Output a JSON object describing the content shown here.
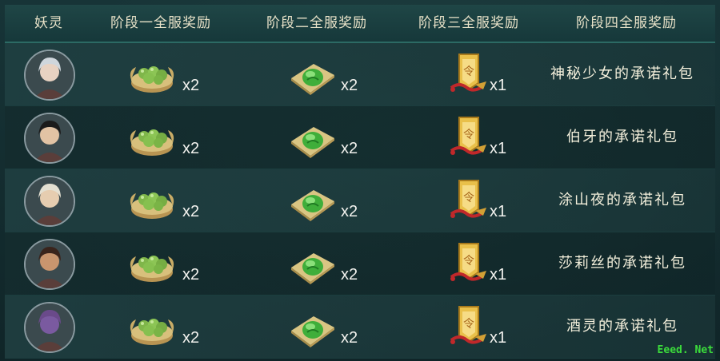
{
  "header": {
    "col_spirit": "妖灵",
    "col_stage1": "阶段一全服奖励",
    "col_stage2": "阶段二全服奖励",
    "col_stage3": "阶段三全服奖励",
    "col_stage4": "阶段四全服奖励"
  },
  "rows": [
    {
      "stage1_qty": "x2",
      "stage2_qty": "x2",
      "stage3_qty": "x1",
      "gift": "神秘少女的承诺礼包",
      "avatar_icon": "silver-hair-girl-avatar"
    },
    {
      "stage1_qty": "x2",
      "stage2_qty": "x2",
      "stage3_qty": "x1",
      "gift": "伯牙的承诺礼包",
      "avatar_icon": "black-hair-man-avatar"
    },
    {
      "stage1_qty": "x2",
      "stage2_qty": "x2",
      "stage3_qty": "x1",
      "gift": "涂山夜的承诺礼包",
      "avatar_icon": "white-hair-man-avatar"
    },
    {
      "stage1_qty": "x2",
      "stage2_qty": "x2",
      "stage3_qty": "x1",
      "gift": "莎莉丝的承诺礼包",
      "avatar_icon": "dark-hair-woman-avatar"
    },
    {
      "stage1_qty": "x2",
      "stage2_qty": "x2",
      "stage3_qty": "x1",
      "gift": "酒灵的承诺礼包",
      "avatar_icon": "wine-jar-avatar"
    }
  ],
  "icons": {
    "stage1": "green-dumplings-basket-icon",
    "stage2": "green-jade-plate-icon",
    "stage3": "golden-token-icon"
  },
  "colors": {
    "header_text": "#e8e2c8",
    "qty_text": "#f2f2ee",
    "watermark": "#3bdc3b"
  },
  "watermark": "Eeed. Net"
}
